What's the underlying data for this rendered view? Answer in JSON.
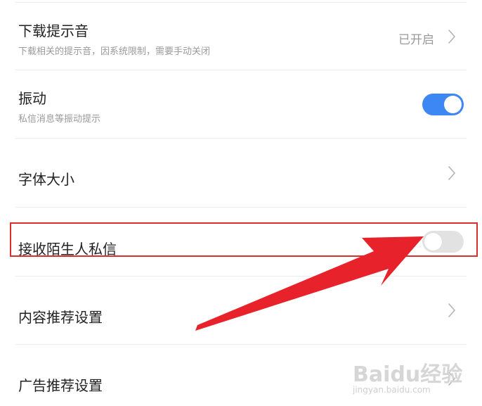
{
  "settings": {
    "rows": [
      {
        "title": "下载提示音",
        "subtitle": "下载相关的提示音，因系统限制，需要手动关闭",
        "value": "已开启",
        "control": "chevron-right-icon"
      },
      {
        "title": "振动",
        "subtitle": "私信消息等振动提示",
        "control": "toggle",
        "toggle_on": true
      },
      {
        "title": "字体大小",
        "control": "chevron-right-icon"
      },
      {
        "title": "接收陌生人私信",
        "control": "toggle",
        "toggle_on": false
      },
      {
        "title": "内容推荐设置",
        "control": "chevron-right-icon"
      },
      {
        "title": "广告推荐设置",
        "control": "chevron-right-icon"
      }
    ]
  },
  "annotation": {
    "highlight_color": "#d9302c",
    "arrow_color": "#e8222a"
  },
  "watermark": {
    "logo": "Baidu经验",
    "url": "jingyan.baidu.com"
  },
  "colors": {
    "toggle_on": "#3d87f5",
    "toggle_off": "#e2e2e2",
    "divider": "#ececec"
  }
}
